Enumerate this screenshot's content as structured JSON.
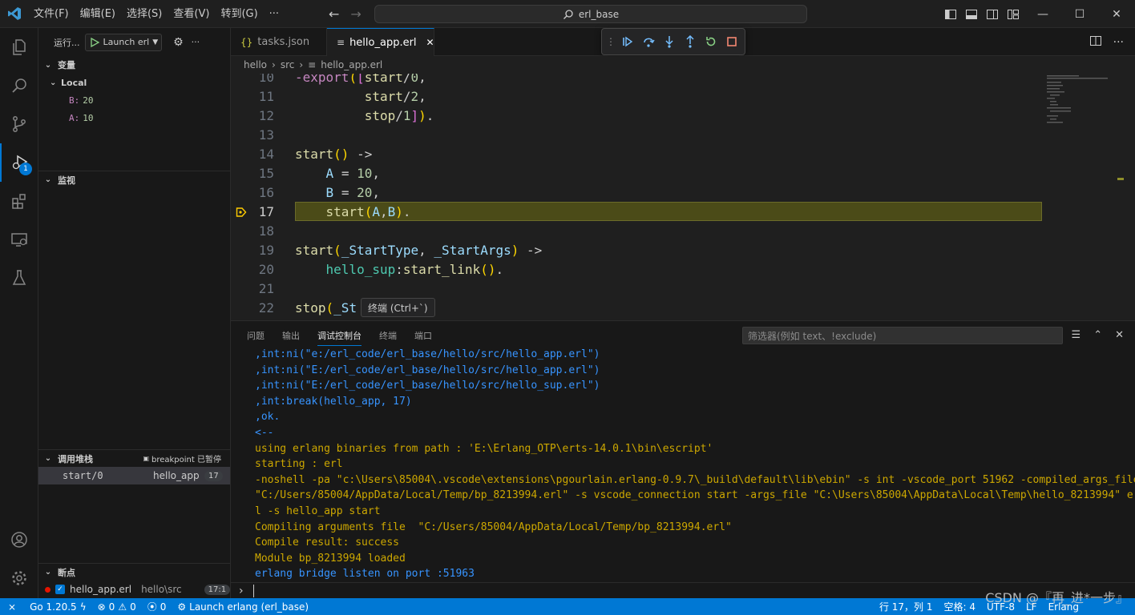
{
  "menu": [
    "文件(F)",
    "编辑(E)",
    "选择(S)",
    "查看(V)",
    "转到(G)",
    "···"
  ],
  "search": {
    "text": "erl_base"
  },
  "window_controls": {
    "minimize": "—",
    "maximize": "☐",
    "close": "✕"
  },
  "activity": {
    "debug_badge": "1"
  },
  "sidebar": {
    "run_label": "运行...",
    "launch_config": "Launch erl",
    "variables_title": "变量",
    "local_label": "Local",
    "variables": [
      {
        "name": "B:",
        "value": "20"
      },
      {
        "name": "A:",
        "value": "10"
      }
    ],
    "watch_title": "监视",
    "callstack_title": "调用堆栈",
    "callstack_status": "breakpoint 已暂停",
    "callstack_frame": {
      "name": "start/0",
      "file": "hello_app",
      "line": "17"
    },
    "breakpoints_title": "断点",
    "breakpoint": {
      "file": "hello_app.erl",
      "path": "hello\\src",
      "pos": "17:1"
    }
  },
  "tabs": [
    {
      "label": "tasks.json"
    },
    {
      "label": "hello_app.erl",
      "close": "✕"
    }
  ],
  "breadcrumb": [
    "hello",
    "src",
    "hello_app.erl"
  ],
  "editor": {
    "line_numbers": [
      "10",
      "11",
      "12",
      "13",
      "14",
      "15",
      "16",
      "17",
      "18",
      "19",
      "20",
      "21",
      "22"
    ],
    "current_line": "17",
    "tooltip": "终端 (Ctrl+`)"
  },
  "panel": {
    "tabs": [
      "问题",
      "输出",
      "调试控制台",
      "终端",
      "端口"
    ],
    "active_tab": "调试控制台",
    "filter_placeholder": "筛选器(例如 text、!exclude)",
    "console_lines": [
      {
        "text": ",int:ni(\"e:/erl_code/erl_base/hello/src/hello_app.erl\")",
        "color": "blue"
      },
      {
        "text": ",int:ni(\"E:/erl_code/erl_base/hello/src/hello_app.erl\")",
        "color": "blue"
      },
      {
        "text": ",int:ni(\"E:/erl_code/erl_base/hello/src/hello_sup.erl\")",
        "color": "blue"
      },
      {
        "text": ",int:break(hello_app, 17)",
        "color": "blue"
      },
      {
        "text": ",ok.",
        "color": "blue"
      },
      {
        "text": "<--",
        "color": "blue"
      },
      {
        "text": "using erlang binaries from path : 'E:\\Erlang_OTP\\erts-14.0.1\\bin\\escript'",
        "color": "orange"
      },
      {
        "text": "starting : erl",
        "color": "orange"
      },
      {
        "text": "-noshell -pa \"c:\\Users\\85004\\.vscode\\extensions\\pgourlain.erlang-0.9.7\\_build\\default\\lib\\ebin\" -s int -vscode_port 51962 -compiled_args_file",
        "color": "orange"
      },
      {
        "text": "\"C:/Users/85004/AppData/Local/Temp/bp_8213994.erl\" -s vscode_connection start -args_file \"C:\\Users\\85004\\AppData\\Local\\Temp\\hello_8213994\" er",
        "color": "orange"
      },
      {
        "text": "l -s hello_app start",
        "color": "orange"
      },
      {
        "text": "Compiling arguments file  \"C:/Users/85004/AppData/Local/Temp/bp_8213994.erl\"",
        "color": "orange"
      },
      {
        "text": "Compile result: success",
        "color": "orange"
      },
      {
        "text": "Module bp_8213994 loaded",
        "color": "orange"
      },
      {
        "text": "erlang bridge listen on port :51963",
        "color": "blue"
      }
    ]
  },
  "statusbar": {
    "go_version": "Go 1.20.5",
    "errors": "0",
    "warnings": "0",
    "ports": "0",
    "launch": "Launch erlang (erl_base)",
    "position": "行 17，列 1",
    "spaces": "空格: 4",
    "encoding": "UTF-8",
    "eol": "LF",
    "language": "Erlang"
  },
  "watermark": "CSDN @『再_进*一步』",
  "colors": {
    "accent": "#0078d4",
    "statusbar": "#0078d4",
    "current_line": "#4b4b18"
  }
}
